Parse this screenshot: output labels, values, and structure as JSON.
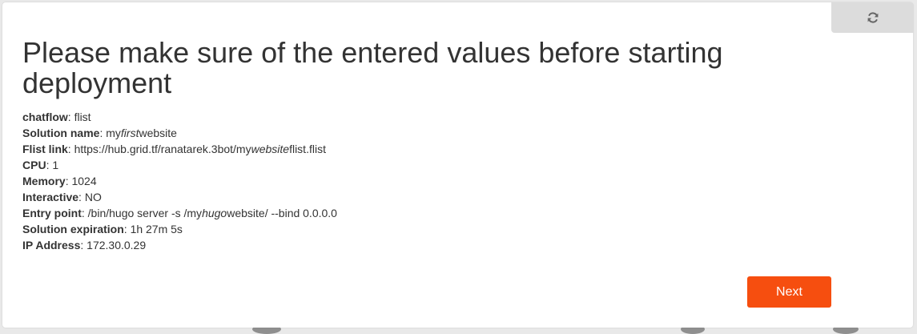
{
  "dialog": {
    "title": "Please make sure of the entered values before starting deployment",
    "details": [
      {
        "label": "chatflow",
        "separator": ": ",
        "value": "flist"
      },
      {
        "label": "Solution name",
        "separator": ": ",
        "value_parts": [
          {
            "text": "my",
            "italic": false
          },
          {
            "text": "first",
            "italic": true
          },
          {
            "text": "website",
            "italic": false
          }
        ]
      },
      {
        "label": "Flist link",
        "separator": ": ",
        "value_parts": [
          {
            "text": "https://hub.grid.tf/ranatarek.3bot/my",
            "italic": false
          },
          {
            "text": "website",
            "italic": true
          },
          {
            "text": "flist.flist",
            "italic": false
          }
        ]
      },
      {
        "label": "CPU",
        "separator": ": ",
        "value": "1"
      },
      {
        "label": "Memory",
        "separator": ": ",
        "value": "1024"
      },
      {
        "label": "Interactive",
        "separator": ": ",
        "value": "NO"
      },
      {
        "label": "Entry point",
        "separator": ": ",
        "value_parts": [
          {
            "text": "/bin/hugo server -s /my",
            "italic": false
          },
          {
            "text": "hugo",
            "italic": true
          },
          {
            "text": "website/ --bind 0.0.0.0",
            "italic": false
          }
        ]
      },
      {
        "label": "Solution expiration",
        "separator": ": ",
        "value": "1h 27m 5s"
      },
      {
        "label": "IP Address",
        "separator": ": ",
        "value": "172.30.0.29"
      }
    ],
    "next_label": "Next",
    "refresh_icon": "refresh-icon"
  },
  "colors": {
    "accent": "#f64e0f",
    "text": "#333333",
    "refresh_bg": "#dcdcdc",
    "page_bg": "#e9e9e9"
  }
}
